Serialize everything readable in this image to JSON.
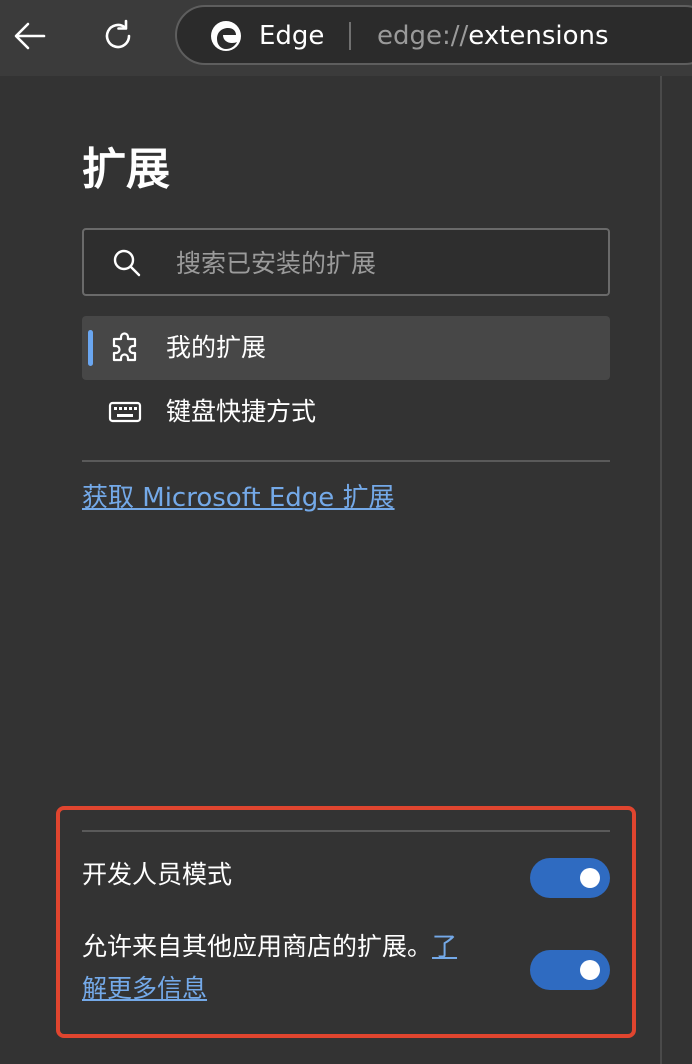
{
  "browser": {
    "brand": "Edge",
    "url_scheme": "edge://",
    "url_path": "extensions"
  },
  "page": {
    "title": "扩展"
  },
  "search": {
    "placeholder": "搜索已安装的扩展"
  },
  "nav": {
    "items": [
      {
        "label": "我的扩展",
        "icon": "puzzle-icon",
        "active": true
      },
      {
        "label": "键盘快捷方式",
        "icon": "keyboard-icon",
        "active": false
      }
    ]
  },
  "store_link": {
    "label": "获取 Microsoft Edge 扩展"
  },
  "settings": {
    "developer_mode": {
      "label": "开发人员模式",
      "enabled": true
    },
    "other_stores": {
      "label": "允许来自其他应用商店的扩展。",
      "learn_more_line1": "了",
      "learn_more_line2": "解更多信息",
      "enabled": true
    }
  },
  "colors": {
    "background": "#333333",
    "accent": "#74a9e8",
    "toggle_on": "#2f6bc1",
    "highlight": "#e0452f"
  }
}
